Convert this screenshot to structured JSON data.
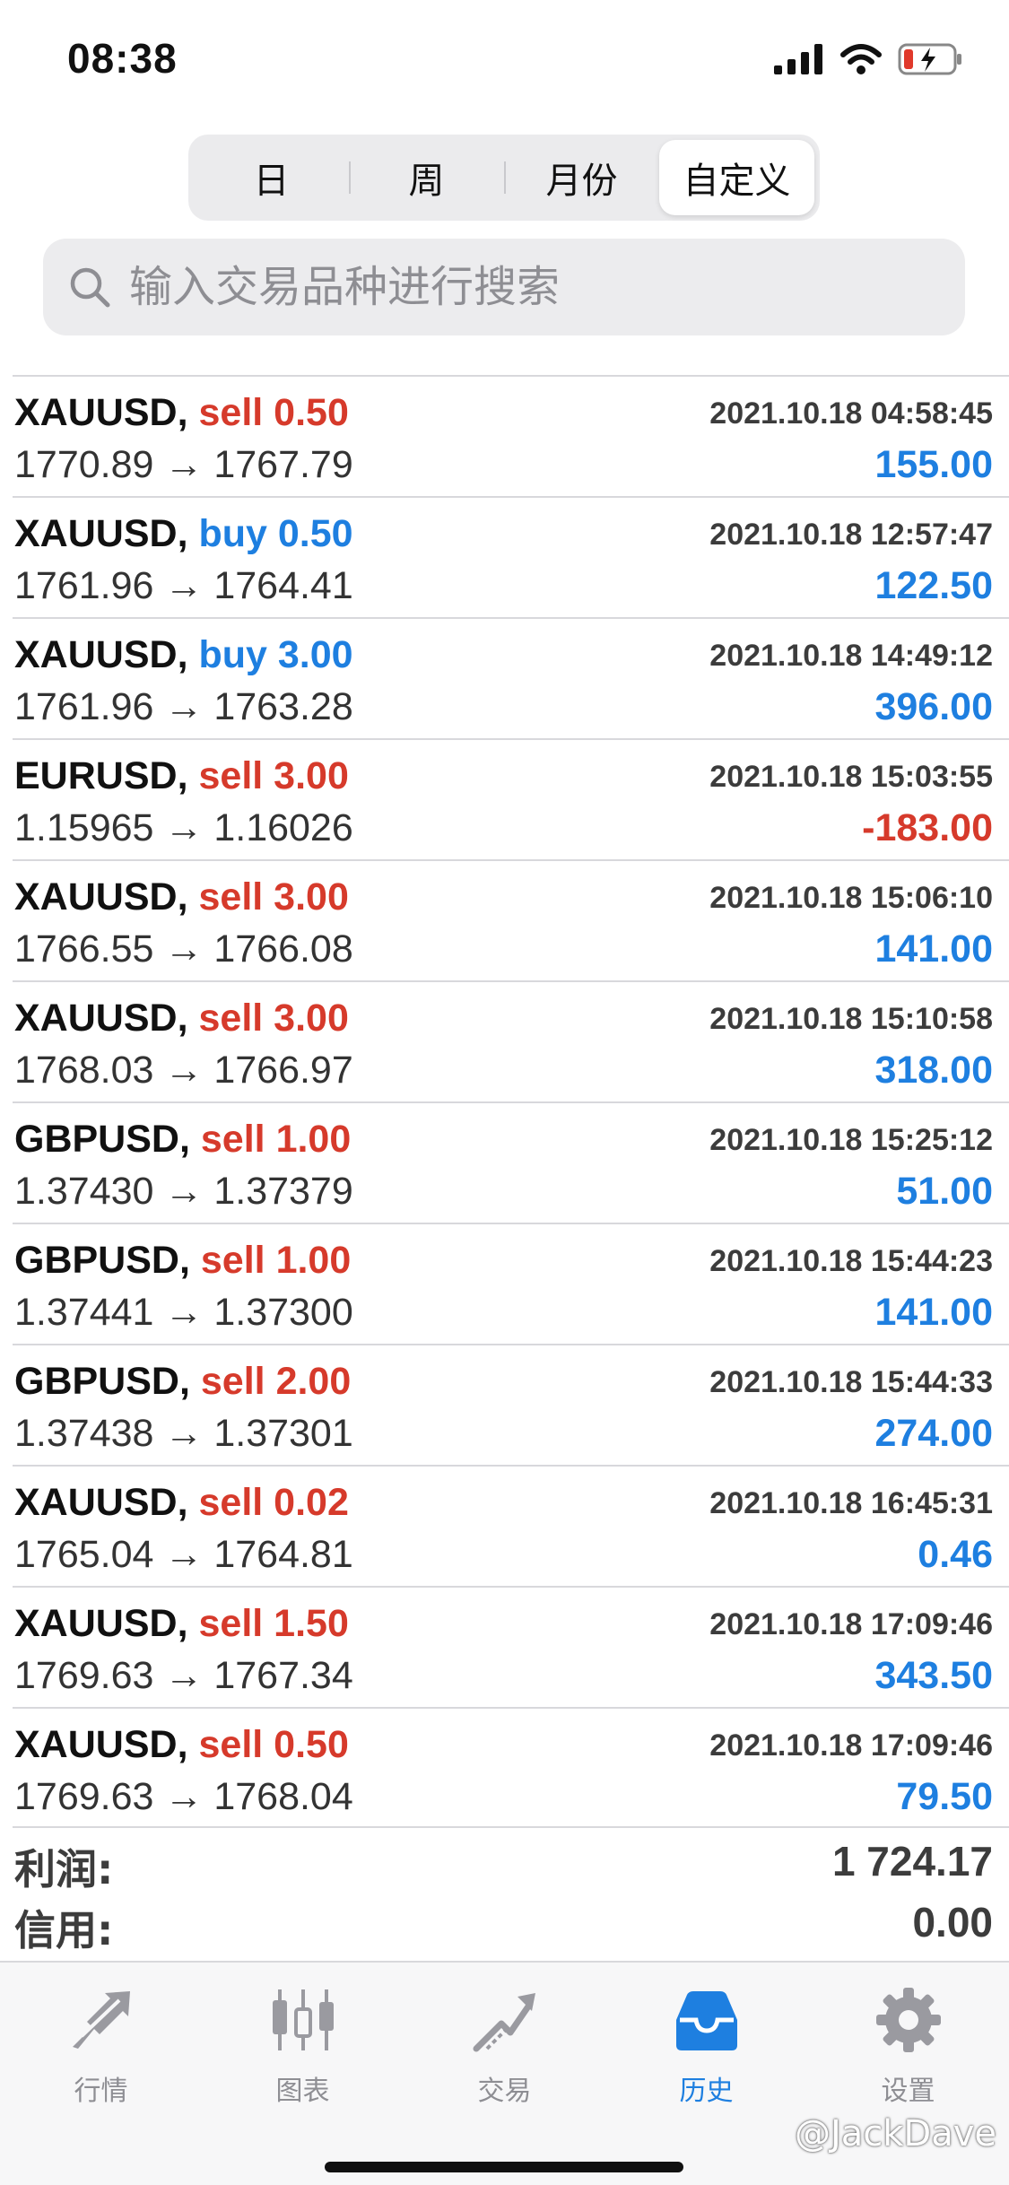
{
  "status_bar": {
    "time": "08:38"
  },
  "period_tabs": [
    "日",
    "周",
    "月份",
    "自定义"
  ],
  "active_period": "自定义",
  "search": {
    "placeholder": "输入交易品种进行搜索"
  },
  "deals": [
    {
      "symbol": "XAUUSD,",
      "type": "sell",
      "volume": "0.50",
      "time": "2021.10.18 04:58:45",
      "prices": "1770.89 → 1767.79",
      "profit": "155.00",
      "sign": "pos"
    },
    {
      "symbol": "XAUUSD,",
      "type": "buy",
      "volume": "0.50",
      "time": "2021.10.18 12:57:47",
      "prices": "1761.96 → 1764.41",
      "profit": "122.50",
      "sign": "pos"
    },
    {
      "symbol": "XAUUSD,",
      "type": "buy",
      "volume": "3.00",
      "time": "2021.10.18 14:49:12",
      "prices": "1761.96 → 1763.28",
      "profit": "396.00",
      "sign": "pos"
    },
    {
      "symbol": "EURUSD,",
      "type": "sell",
      "volume": "3.00",
      "time": "2021.10.18 15:03:55",
      "prices": "1.15965 → 1.16026",
      "profit": "-183.00",
      "sign": "neg"
    },
    {
      "symbol": "XAUUSD,",
      "type": "sell",
      "volume": "3.00",
      "time": "2021.10.18 15:06:10",
      "prices": "1766.55 → 1766.08",
      "profit": "141.00",
      "sign": "pos"
    },
    {
      "symbol": "XAUUSD,",
      "type": "sell",
      "volume": "3.00",
      "time": "2021.10.18 15:10:58",
      "prices": "1768.03 → 1766.97",
      "profit": "318.00",
      "sign": "pos"
    },
    {
      "symbol": "GBPUSD,",
      "type": "sell",
      "volume": "1.00",
      "time": "2021.10.18 15:25:12",
      "prices": "1.37430 → 1.37379",
      "profit": "51.00",
      "sign": "pos"
    },
    {
      "symbol": "GBPUSD,",
      "type": "sell",
      "volume": "1.00",
      "time": "2021.10.18 15:44:23",
      "prices": "1.37441 → 1.37300",
      "profit": "141.00",
      "sign": "pos"
    },
    {
      "symbol": "GBPUSD,",
      "type": "sell",
      "volume": "2.00",
      "time": "2021.10.18 15:44:33",
      "prices": "1.37438 → 1.37301",
      "profit": "274.00",
      "sign": "pos"
    },
    {
      "symbol": "XAUUSD,",
      "type": "sell",
      "volume": "0.02",
      "time": "2021.10.18 16:45:31",
      "prices": "1765.04 → 1764.81",
      "profit": "0.46",
      "sign": "pos"
    },
    {
      "symbol": "XAUUSD,",
      "type": "sell",
      "volume": "1.50",
      "time": "2021.10.18 17:09:46",
      "prices": "1769.63 → 1767.34",
      "profit": "343.50",
      "sign": "pos"
    },
    {
      "symbol": "XAUUSD,",
      "type": "sell",
      "volume": "0.50",
      "time": "2021.10.18 17:09:46",
      "prices": "1769.63 → 1768.04",
      "profit": "79.50",
      "sign": "pos"
    }
  ],
  "summary": {
    "profit_label": "利润:",
    "profit_value": "1 724.17",
    "credit_label": "信用:",
    "credit_value": "0.00"
  },
  "tab_bar": [
    {
      "label": "行情",
      "icon": "quotes-icon"
    },
    {
      "label": "图表",
      "icon": "chart-icon"
    },
    {
      "label": "交易",
      "icon": "trade-icon"
    },
    {
      "label": "历史",
      "icon": "history-icon"
    },
    {
      "label": "设置",
      "icon": "settings-icon"
    }
  ],
  "active_tab": "历史",
  "watermark": "@JackDave",
  "colors": {
    "sell": "#d63a2b",
    "buy": "#1e7fe0",
    "accent": "#1e7fe0",
    "inactive": "#8e8e93"
  }
}
